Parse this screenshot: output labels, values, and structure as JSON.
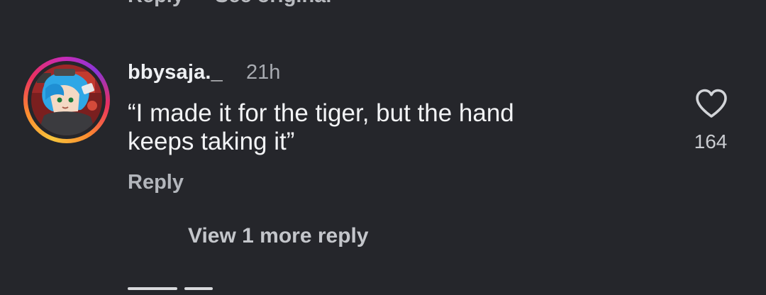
{
  "previous_comment": {
    "reply_label": "Reply",
    "see_original_label": "See original"
  },
  "comment": {
    "username": "bbysaja._",
    "timestamp": "21h",
    "text": "“I made it for the tiger, but the hand\nkeeps taking it”",
    "reply_label": "Reply",
    "likes": "164",
    "like_icon": "heart-outline-icon",
    "avatar": "profile-avatar-anime-character-blue-hair",
    "view_replies_label": "View 1 more reply"
  },
  "colors": {
    "background": "#25262b",
    "primary_text": "#f2f3f5",
    "secondary_text": "#b3b6bc"
  }
}
